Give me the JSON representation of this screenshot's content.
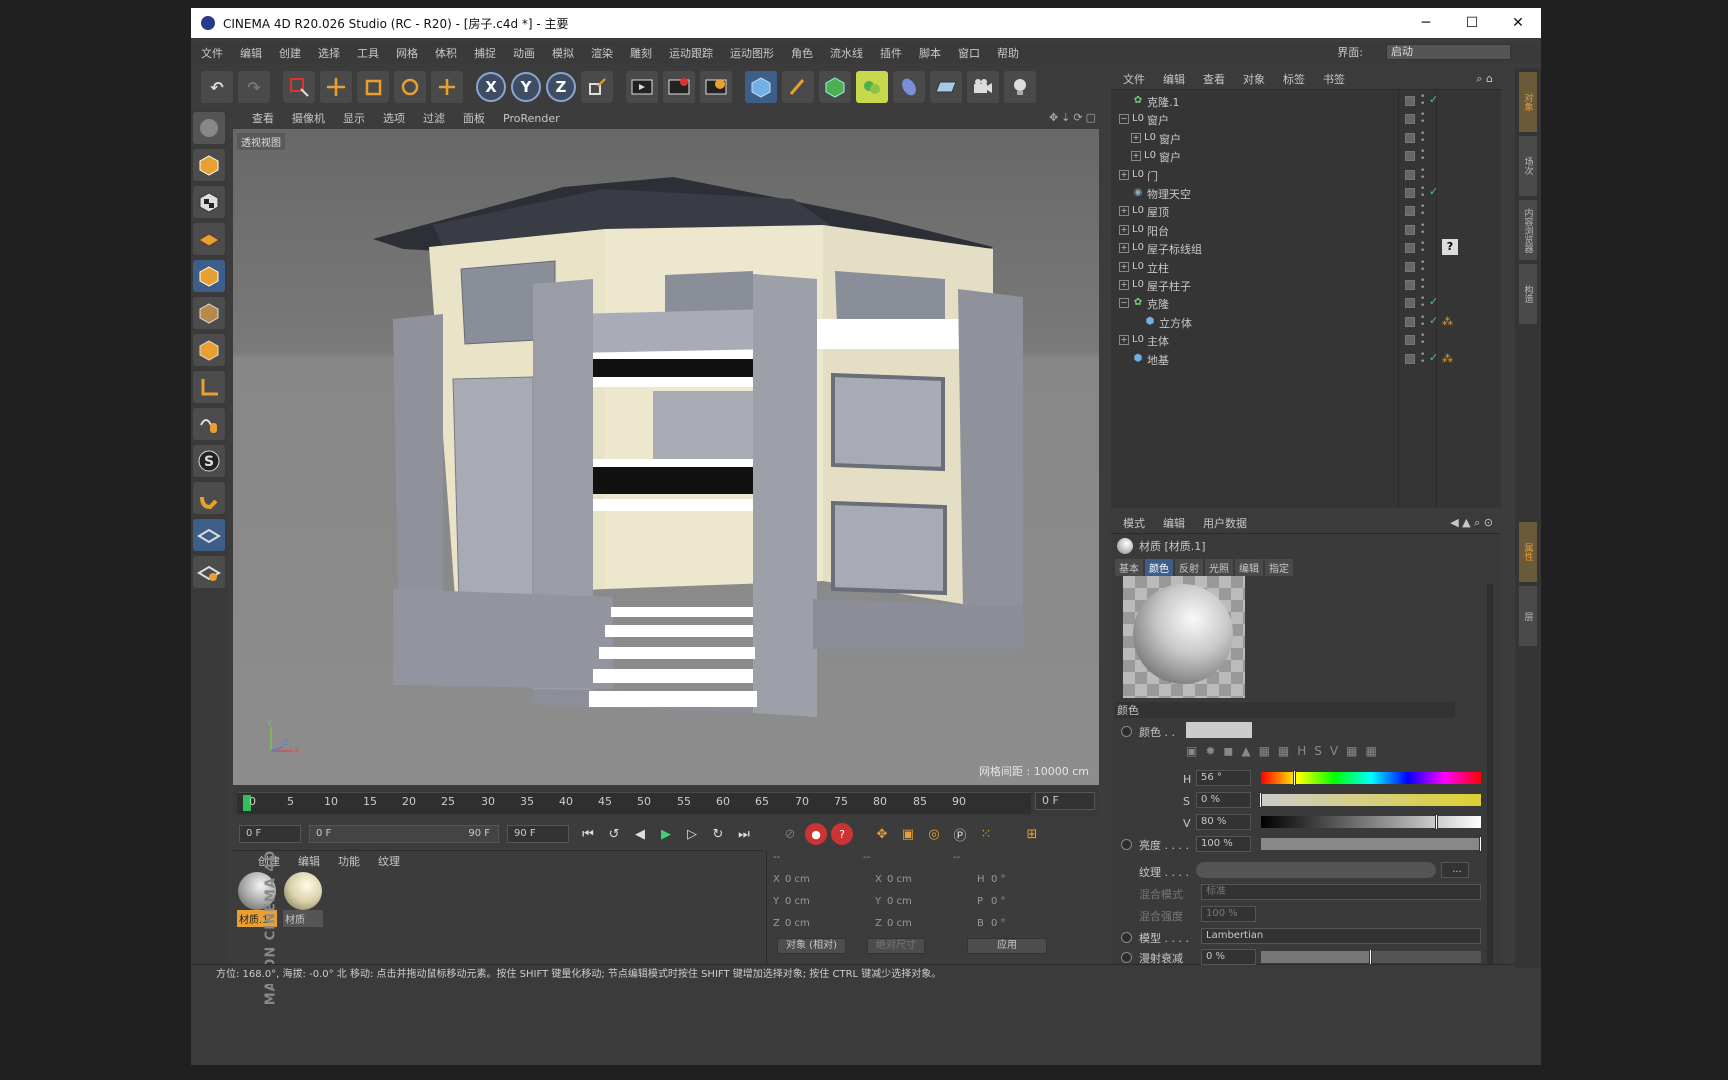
{
  "window": {
    "title": "CINEMA 4D R20.026 Studio (RC - R20) - [房子.c4d *] - 主要",
    "minimize": "─",
    "maximize": "☐",
    "close": "✕"
  },
  "menu": [
    "文件",
    "编辑",
    "创建",
    "选择",
    "工具",
    "网格",
    "体积",
    "捕捉",
    "动画",
    "模拟",
    "渲染",
    "雕刻",
    "运动跟踪",
    "运动图形",
    "角色",
    "流水线",
    "插件",
    "脚本",
    "窗口",
    "帮助"
  ],
  "layout": {
    "label": "界面:",
    "value": "启动"
  },
  "toolbar": {
    "undo": "↶",
    "redo": "↷",
    "x_axis": "X",
    "y_axis": "Y",
    "z_axis": "Z"
  },
  "viewport": {
    "menu": [
      "查看",
      "摄像机",
      "显示",
      "选项",
      "过滤",
      "面板",
      "ProRender"
    ],
    "label": "透视视图",
    "grid_info": "网格间距 : 10000 cm",
    "axis_y": "Y",
    "axis_z": "Z",
    "axis_x": "X"
  },
  "timeline": {
    "ticks": [
      "0",
      "5",
      "10",
      "15",
      "20",
      "25",
      "30",
      "35",
      "40",
      "45",
      "50",
      "55",
      "60",
      "65",
      "70",
      "75",
      "80",
      "85",
      "90"
    ],
    "current": "0 F",
    "start": "0 F",
    "range_start": "0 F",
    "range_end": "90 F",
    "end": "90 F"
  },
  "material_manager": {
    "tabs": [
      "创建",
      "编辑",
      "功能",
      "纹理"
    ],
    "materials": [
      {
        "name": "材质.1",
        "selected": true
      },
      {
        "name": "材质",
        "selected": false
      }
    ]
  },
  "coordinates": {
    "rows": [
      [
        "X",
        "0 cm",
        "X",
        "0 cm",
        "H",
        "0 °"
      ],
      [
        "Y",
        "0 cm",
        "Y",
        "0 cm",
        "P",
        "0 °"
      ],
      [
        "Z",
        "0 cm",
        "Z",
        "0 cm",
        "B",
        "0 °"
      ]
    ],
    "mode": "对象 (相对)",
    "size": "绝对尺寸",
    "apply": "应用",
    "header": [
      "--",
      "--",
      "--"
    ]
  },
  "status": "方位: 168.0°, 海拔: -0.0° 北    移动: 点击并拖动鼠标移动元素。按住 SHIFT 键量化移动; 节点编辑模式时按住 SHIFT 键增加选择对象; 按住 CTRL 键减少选择对象。",
  "objects": {
    "tabs": [
      "文件",
      "编辑",
      "查看",
      "对象",
      "标签",
      "书签"
    ],
    "items": [
      {
        "name": "克隆.1",
        "icon": "cloner",
        "indent": 0,
        "tree": "",
        "check": true,
        "tag": ""
      },
      {
        "name": "窗户",
        "icon": "null",
        "indent": 0,
        "tree": "−",
        "check": false,
        "tag": ""
      },
      {
        "name": "窗户",
        "icon": "null",
        "indent": 1,
        "tree": "+",
        "check": false,
        "tag": ""
      },
      {
        "name": "窗户",
        "icon": "null",
        "indent": 1,
        "tree": "+",
        "check": false,
        "tag": ""
      },
      {
        "name": "门",
        "icon": "null",
        "indent": 0,
        "tree": "+",
        "check": false,
        "tag": ""
      },
      {
        "name": "物理天空",
        "icon": "sky",
        "indent": 0,
        "tree": "",
        "check": true,
        "tag": ""
      },
      {
        "name": "屋顶",
        "icon": "null",
        "indent": 0,
        "tree": "+",
        "check": false,
        "tag": ""
      },
      {
        "name": "阳台",
        "icon": "null",
        "indent": 0,
        "tree": "+",
        "check": false,
        "tag": ""
      },
      {
        "name": "屋子标线组",
        "icon": "null",
        "indent": 0,
        "tree": "+",
        "check": false,
        "tag": "?"
      },
      {
        "name": "立柱",
        "icon": "null",
        "indent": 0,
        "tree": "+",
        "check": false,
        "tag": ""
      },
      {
        "name": "屋子柱子",
        "icon": "null",
        "indent": 0,
        "tree": "+",
        "check": false,
        "tag": ""
      },
      {
        "name": "克隆",
        "icon": "cloner",
        "indent": 0,
        "tree": "−",
        "check": true,
        "tag": ""
      },
      {
        "name": "立方体",
        "icon": "cube",
        "indent": 1,
        "tree": "",
        "check": true,
        "tag": "p"
      },
      {
        "name": "主体",
        "icon": "null",
        "indent": 0,
        "tree": "+",
        "check": false,
        "tag": ""
      },
      {
        "name": "地基",
        "icon": "cube",
        "indent": 0,
        "tree": "",
        "check": true,
        "tag": "p"
      }
    ]
  },
  "attributes": {
    "tabs": [
      "模式",
      "编辑",
      "用户数据"
    ],
    "title": "材质 [材质.1]",
    "subtabs": [
      "基本",
      "颜色",
      "反射",
      "光照",
      "编辑",
      "指定"
    ],
    "active_subtab": "颜色",
    "section": "颜色",
    "color_label": "颜色 . .",
    "h_label": "H",
    "h_value": "56 °",
    "h_fraction": 0.156,
    "s_label": "S",
    "s_value": "0 %",
    "s_fraction": 0,
    "v_label": "V",
    "v_value": "80 %",
    "v_fraction": 0.8,
    "brightness_label": "亮度 . . . .",
    "brightness_value": "100 %",
    "brightness_fraction": 1.0,
    "texture_label": "纹理 . . . .",
    "texture_btn": "...",
    "blend_mode_label": "混合模式",
    "blend_mode_value": "标准",
    "blend_strength_label": "混合强度",
    "blend_strength_value": "100 %",
    "model_label": "模型 . . . .",
    "model_value": "Lambertian",
    "diffuse_label": "漫射衰减",
    "diffuse_value": "0 %",
    "diffuse_fraction": 0.5
  },
  "right_tabs": [
    "对象",
    "场次",
    "内容浏览器",
    "构造"
  ],
  "right_tabs2": [
    "属性",
    "层"
  ],
  "brand": "MAXON CINEMA 4D"
}
